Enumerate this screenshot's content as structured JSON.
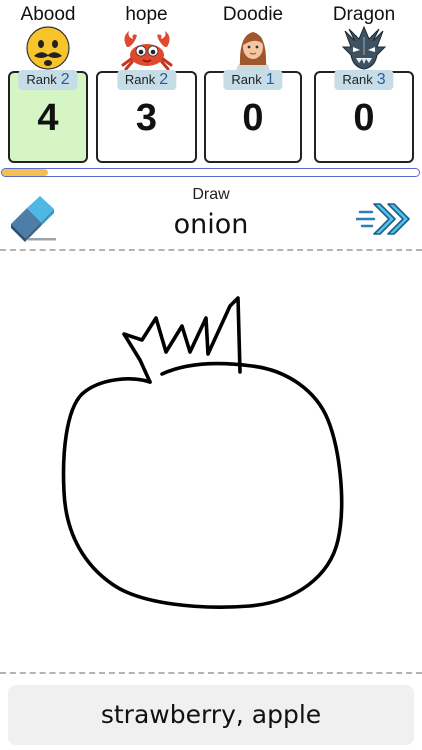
{
  "players": [
    {
      "name": "Abood",
      "avatar": "yellow-mustache-face",
      "rank_label": "Rank",
      "rank": "2",
      "score": "4",
      "active": true
    },
    {
      "name": "hope",
      "avatar": "red-crab",
      "rank_label": "Rank",
      "rank": "2",
      "score": "3",
      "active": false
    },
    {
      "name": "Doodie",
      "avatar": "woman-face",
      "rank_label": "Rank",
      "rank": "1",
      "score": "0",
      "active": false
    },
    {
      "name": "Dragon",
      "avatar": "dragon-head",
      "rank_label": "Rank",
      "rank": "3",
      "score": "0",
      "active": false
    }
  ],
  "timer": {
    "remaining_fraction": 0.11,
    "fill_color": "#f2c14e",
    "border_color": "#5c67d8"
  },
  "prompt": {
    "label": "Draw",
    "word": "onion"
  },
  "toolbar": {
    "eraser_icon": "eraser-icon",
    "skip_icon": "fast-forward-arrows-icon"
  },
  "guess": {
    "text": "strawberry, apple"
  },
  "colors": {
    "active_card": "#d6f5c4",
    "rank_badge": "#c6dce6",
    "rank_number": "#2a5d95",
    "ink": "#000000"
  }
}
